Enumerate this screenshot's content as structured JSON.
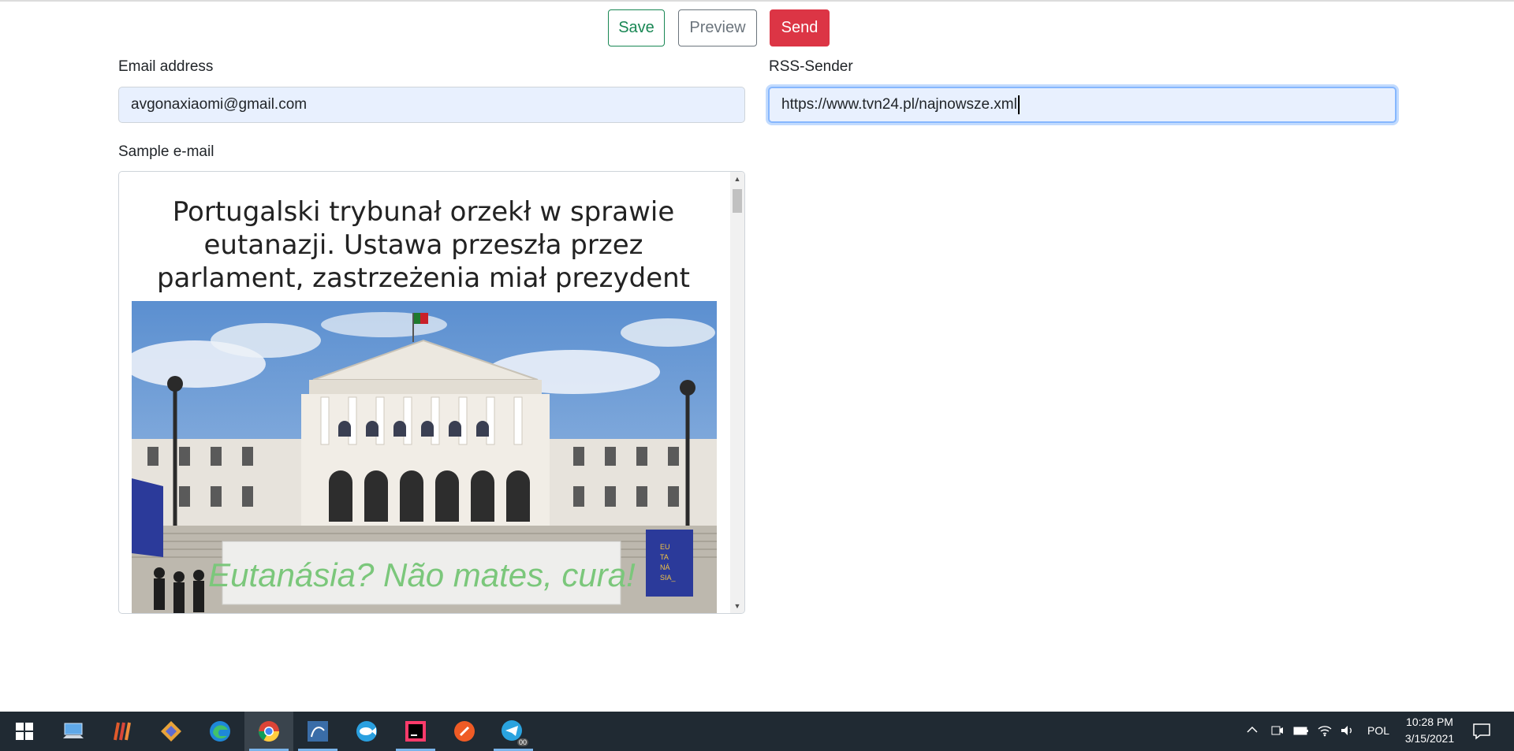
{
  "toolbar": {
    "save_label": "Save",
    "preview_label": "Preview",
    "send_label": "Send"
  },
  "form": {
    "email_label": "Email address",
    "email_value": "avgonaxiaomi@gmail.com",
    "rss_label": "RSS-Sender",
    "rss_value": "https://www.tvn24.pl/najnowsze.xml",
    "sample_label": "Sample e-mail"
  },
  "sample_email": {
    "title": "Portugalski trybunał orzekł w sprawie eutanazji. Ustawa przeszła przez parlament, zastrzeżenia miał prezydent",
    "banner_text": "Eutanásia? Não mates, cura!",
    "flag_text": "EU TA NÁ SIA_"
  },
  "taskbar": {
    "apps": [
      "windows-start",
      "pc-app",
      "winrar",
      "git-tool",
      "edge",
      "chrome",
      "mysql-workbench",
      "docker-fish",
      "intellij",
      "postman",
      "telegram"
    ],
    "active_app": "chrome",
    "telegram_badge": "00",
    "language": "POL",
    "time": "10:28 PM",
    "date": "3/15/2021"
  },
  "colors": {
    "save": "#198754",
    "preview": "#6c757d",
    "send": "#dc3545",
    "input_bg": "#e8f0fe",
    "taskbar": "#202a33"
  }
}
